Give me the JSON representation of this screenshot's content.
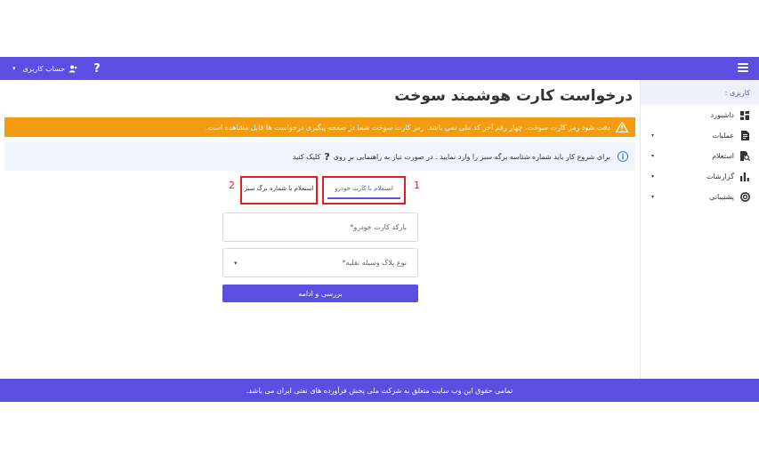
{
  "topbar": {
    "help_icon": "?",
    "account_label": "حساب کاربری",
    "account_caret": "▾"
  },
  "sidebar": {
    "header": "کاربری :",
    "items": [
      {
        "label": "داشبورد",
        "icon": "dashboard-icon",
        "has_arrow": false
      },
      {
        "label": "عملیات",
        "icon": "document-icon",
        "has_arrow": true
      },
      {
        "label": "استعلام",
        "icon": "search-document-icon",
        "has_arrow": true
      },
      {
        "label": "گزارشات",
        "icon": "bar-chart-icon",
        "has_arrow": true
      },
      {
        "label": "پشتیبانی",
        "icon": "support-icon",
        "has_arrow": true
      }
    ],
    "arrow": "▾"
  },
  "main": {
    "title": "درخواست کارت هوشمند سوخت",
    "warning": "دقت شود رمز کارت سوخت، چهار رقم آخر کد ملی نمی باشد. رمز کارت سوخت شما در صفحه پیگیری درخواست ها قابل مشاهده است.",
    "info_icon": "i",
    "info_text": "برای شروع کار باید شماره شناسه برگه سبز را وارد نمایید . در صورت نیاز به راهنمایی بر روی",
    "info_question": "?",
    "info_link": "کلیک کنید",
    "tabs": [
      {
        "label": "استعلام با کارت خودرو",
        "marker": "1"
      },
      {
        "label": "استعلام با شماره برگ سبز",
        "marker": "2"
      }
    ],
    "barcode_placeholder": "بارکد کارت خودرو*",
    "plate_type_placeholder": "نوع پلاک وسیله نقلیه*",
    "dropdown_arrow": "▾",
    "submit_label": "بررسی و ادامه"
  },
  "footer": {
    "text": "تمامی حقوق این وب سایت متعلق به شرکت ملی پخش فرآورده های نفتی ایران می باشد."
  },
  "colors": {
    "primary": "#5b4ee0",
    "warning": "#f39c12",
    "info_bg": "#eef4fb",
    "highlight_red": "#e02020"
  }
}
